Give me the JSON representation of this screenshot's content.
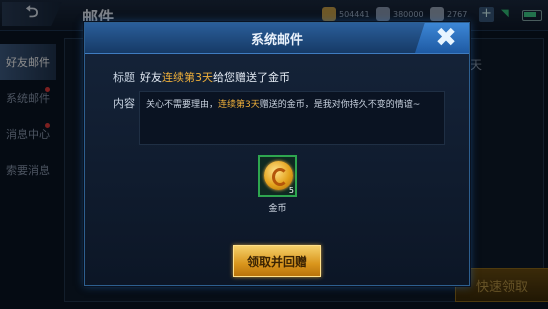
{
  "app": {
    "page_title": "邮件",
    "resources": [
      {
        "name": "coin",
        "value": "504441",
        "color": "#c9a04a"
      },
      {
        "name": "diamond",
        "value": "380000",
        "color": "#8a9bb5"
      },
      {
        "name": "voucher",
        "value": "2767",
        "color": "#9aa8bc"
      }
    ]
  },
  "sidebar": {
    "items": [
      {
        "label": "好友邮件",
        "active": true,
        "badge": false
      },
      {
        "label": "系统邮件",
        "active": false,
        "badge": true
      },
      {
        "label": "消息中心",
        "active": false,
        "badge": true
      },
      {
        "label": "索要消息",
        "active": false,
        "badge": false
      }
    ]
  },
  "background": {
    "right_text": "天",
    "quick_claim_label": "快速领取"
  },
  "dialog": {
    "title": "系统邮件",
    "subject_label": "标题",
    "subject": {
      "pre": "好友",
      "highlight": "连续第3天",
      "post": "给您赠送了金币"
    },
    "content_label": "内容",
    "content": {
      "pre": "关心不需要理由，",
      "highlight": "连续第3天",
      "post": "赠送的金币，是我对你持久不变的情谊~"
    },
    "attachment": {
      "name": "金币",
      "count": "5",
      "icon": "gold-coin-icon"
    },
    "claim_button": "领取并回赠",
    "highlight_color": "#f0b03a"
  }
}
